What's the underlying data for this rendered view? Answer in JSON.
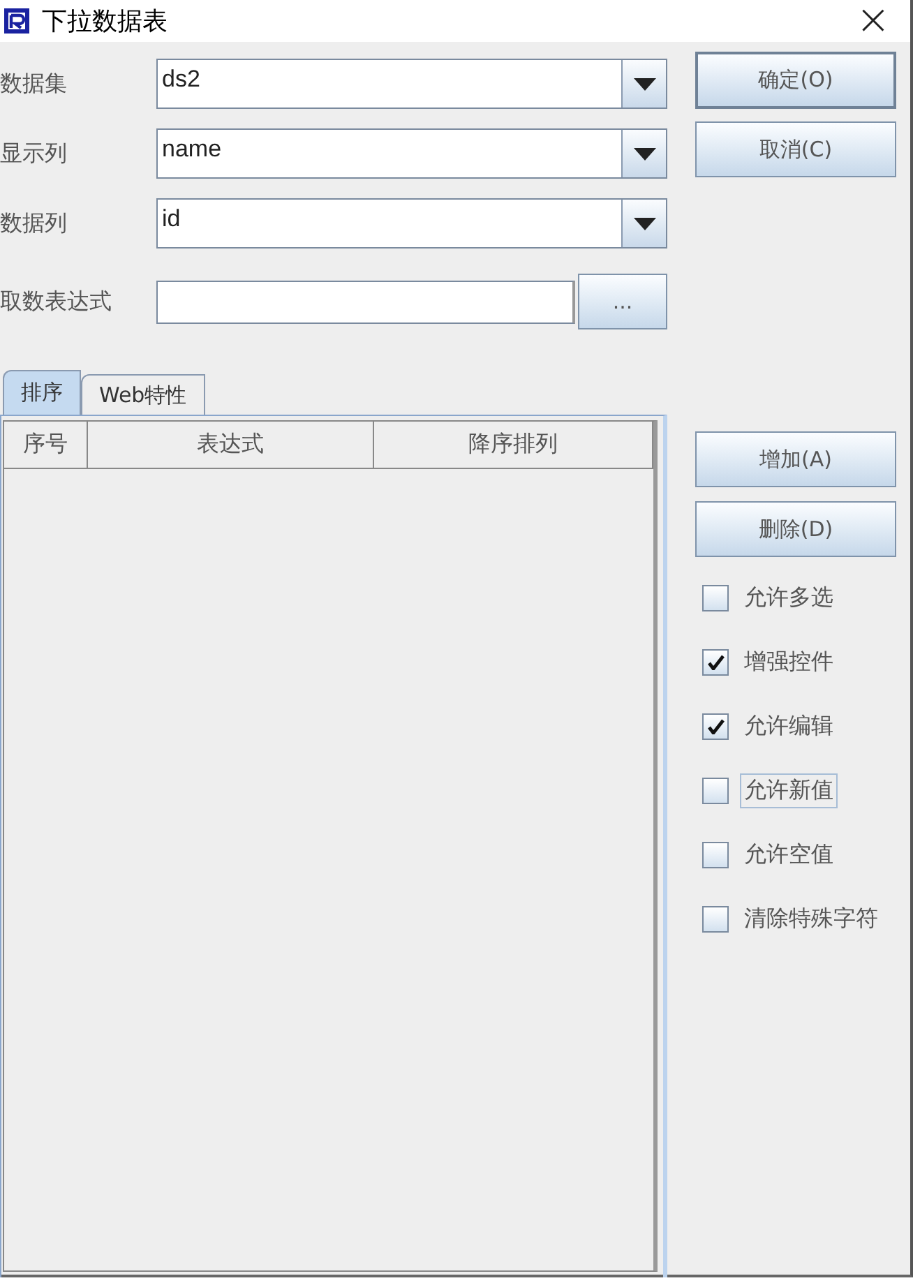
{
  "window": {
    "title": "下拉数据表",
    "close": "×"
  },
  "fields": [
    {
      "kind": "combo",
      "label": "数据集",
      "value": "ds2"
    },
    {
      "kind": "combo",
      "label": "显示列",
      "value": "name"
    },
    {
      "kind": "combo",
      "label": "数据列",
      "value": "id"
    },
    {
      "kind": "text",
      "label": "取数表达式",
      "button": "..."
    }
  ],
  "dialog_buttons": [
    {
      "label": "确定(O)",
      "default": true
    },
    {
      "label": "取消(C)",
      "default": false
    }
  ],
  "tabs": [
    {
      "label": "排序",
      "selected": true
    },
    {
      "label": "Web特性",
      "selected": false
    }
  ],
  "table": {
    "columns": [
      "序号",
      "表达式",
      "降序排列"
    ]
  },
  "row_buttons": [
    {
      "label": "增加(A)"
    },
    {
      "label": "删除(D)"
    }
  ],
  "options": [
    {
      "label": "允许多选",
      "checked": false,
      "focused": false
    },
    {
      "label": "增强控件",
      "checked": true,
      "focused": false
    },
    {
      "label": "允许编辑",
      "checked": true,
      "focused": false
    },
    {
      "label": "允许新值",
      "checked": false,
      "focused": true
    },
    {
      "label": "允许空值",
      "checked": false,
      "focused": false
    },
    {
      "label": "清除特殊字符",
      "checked": false,
      "focused": false
    }
  ]
}
